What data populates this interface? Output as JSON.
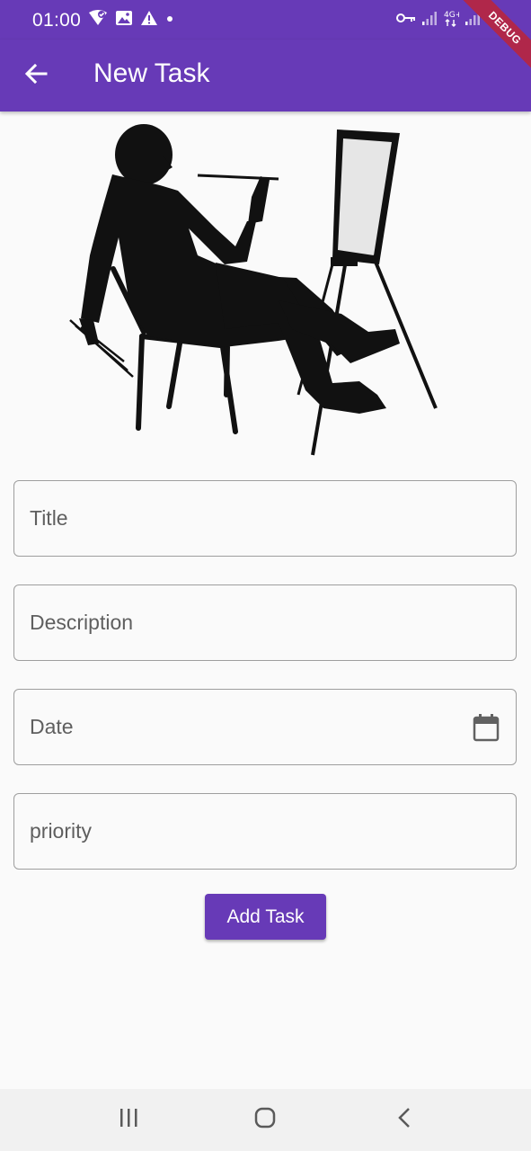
{
  "status_bar": {
    "time": "01:00",
    "left_icons": [
      "wifi-heart-icon",
      "image-icon",
      "warning-icon",
      "dot-icon"
    ],
    "right_icons": [
      "key-icon",
      "signal-icon",
      "network-4g-icon",
      "signal-icon"
    ]
  },
  "app_bar": {
    "title": "New Task",
    "back_icon": "arrow-back-icon"
  },
  "debug_banner": "DEBUG",
  "form": {
    "title_placeholder": "Title",
    "description_placeholder": "Description",
    "date_placeholder": "Date",
    "priority_placeholder": "priority",
    "date_icon": "calendar-icon"
  },
  "submit_label": "Add Task",
  "colors": {
    "primary": "#673ab7",
    "background": "#fafafa",
    "nav_bar": "#f1f1f1"
  },
  "nav_bar": {
    "icons": [
      "recent-apps-icon",
      "home-icon",
      "back-icon"
    ]
  }
}
